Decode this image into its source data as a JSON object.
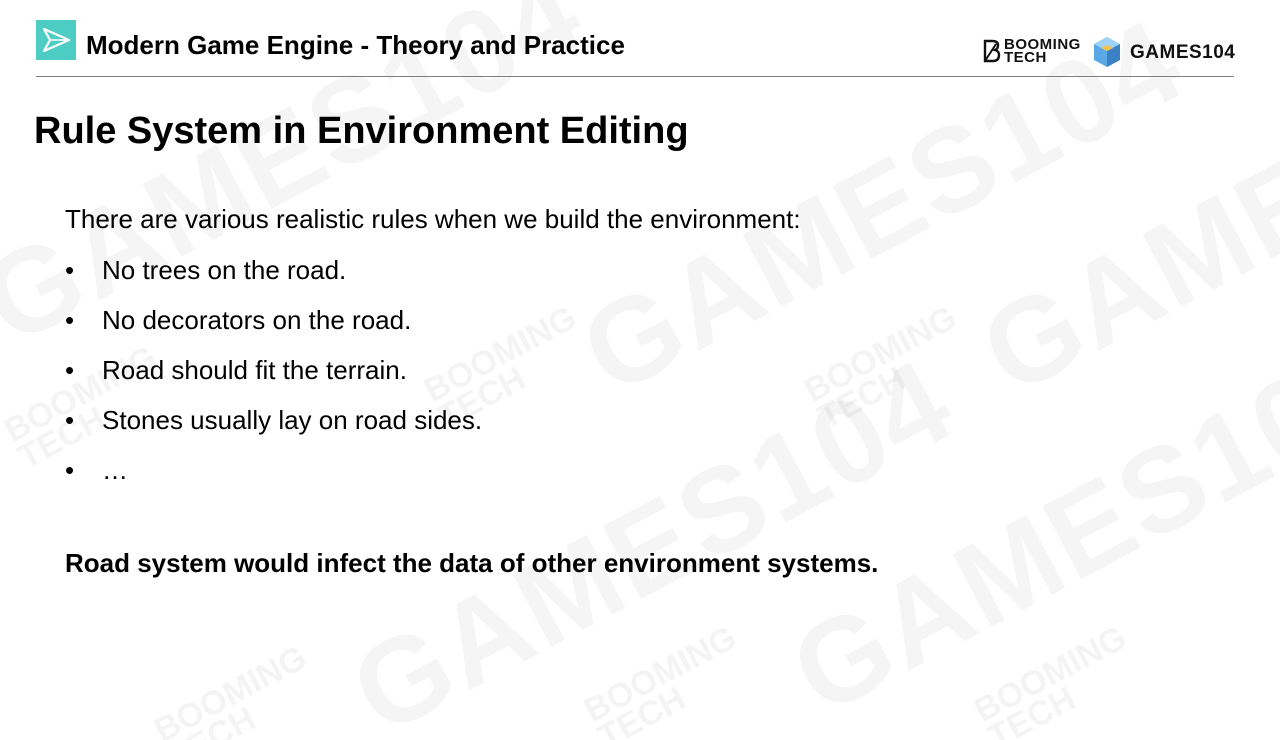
{
  "header": {
    "title": "Modern Game Engine - Theory and Practice",
    "logo_booming_line1": "BOOMING",
    "logo_booming_line2": "TECH",
    "logo_games": "GAMES104"
  },
  "slide": {
    "title": "Rule System in Environment Editing",
    "intro": "There are various realistic rules when we build the environment:",
    "bullet_symbol": "•",
    "bullets": [
      "No trees on the road.",
      "No decorators on the road.",
      "Road should fit the terrain.",
      "Stones usually lay on road sides.",
      "…"
    ],
    "conclusion": "Road system would infect the data of other environment systems."
  },
  "watermark": {
    "games": "GAMES104",
    "booming_line1": "BOOMING",
    "booming_line2": "TECH"
  },
  "colors": {
    "accent_icon": "#4ecdc4",
    "games_icon_blue": "#5aa9e6",
    "games_icon_yellow": "#f2c14e"
  }
}
